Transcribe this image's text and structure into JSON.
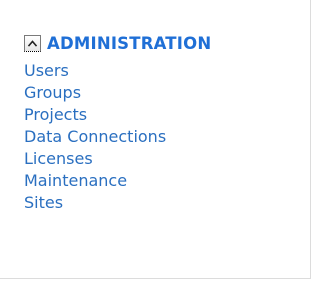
{
  "section": {
    "title": "ADMINISTRATION",
    "toggle_icon": "chevron-up-icon",
    "colors": {
      "title": "#1f6fd6",
      "link": "#2a6fc0"
    },
    "items": [
      {
        "label": "Users"
      },
      {
        "label": "Groups"
      },
      {
        "label": "Projects"
      },
      {
        "label": "Data Connections"
      },
      {
        "label": "Licenses"
      },
      {
        "label": "Maintenance"
      },
      {
        "label": "Sites"
      }
    ]
  }
}
